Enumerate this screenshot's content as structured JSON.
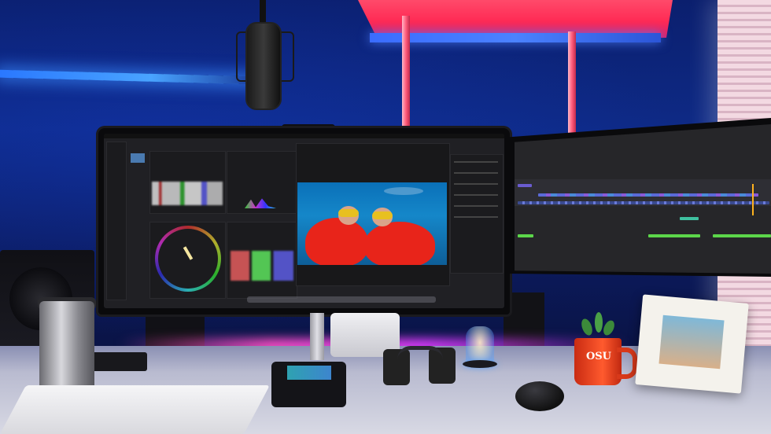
{
  "scene": {
    "description_tag": "desk-setup-photo",
    "colors": {
      "wall": "#0e2a86",
      "shelf_light": "#ff2b55",
      "led_strip": "#49a4ff",
      "desk_glow": "#dc3cff",
      "mug": "#ff5a2e"
    }
  },
  "main_monitor": {
    "video_overlay": "",
    "status_text": ""
  },
  "mug": {
    "text": "OSU"
  }
}
